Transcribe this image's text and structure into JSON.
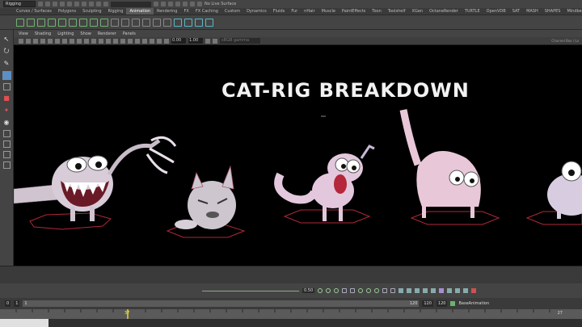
{
  "status": {
    "menu_set": "Rigging",
    "live_surface": "No Live Surface"
  },
  "shelf_tabs": [
    "Curves / Surfaces",
    "Polygons",
    "Sculpting",
    "Rigging",
    "Animation",
    "Rendering",
    "FX",
    "FX Caching",
    "Custom",
    "Dynamics",
    "Fluids",
    "Fur",
    "nHair",
    "Muscle",
    "PaintEffects",
    "Toon",
    "Toolshelf",
    "XGen",
    "OctaneRender",
    "TURTLE",
    "OpenVDB",
    "SAT",
    "MASH",
    "SHAPES",
    "Mindbender"
  ],
  "active_shelf_tab": "Animation",
  "viewport_menu": [
    "View",
    "Shading",
    "Lighting",
    "Show",
    "Renderer",
    "Panels"
  ],
  "viewport_toolbar": {
    "near": "0.00",
    "far": "1.00",
    "color_space": "sRGB gamma"
  },
  "channel_box_label": "Channel Box / La",
  "viewport_title": "CAT-RIG  BREAKDOWN",
  "playback": {
    "speed": "0.50"
  },
  "range": {
    "start": "0",
    "anim_start": "1",
    "range_start": "1",
    "range_end": "120",
    "end": "120",
    "anim_end": "120",
    "layer": "BaseAnimation"
  },
  "timeline": {
    "current_frame": "37",
    "end_frame": "27"
  },
  "colors": {
    "accent_tab": "#5a5a5a",
    "selected_tool": "#5d8fc4",
    "playhead": "#c9b04a"
  }
}
